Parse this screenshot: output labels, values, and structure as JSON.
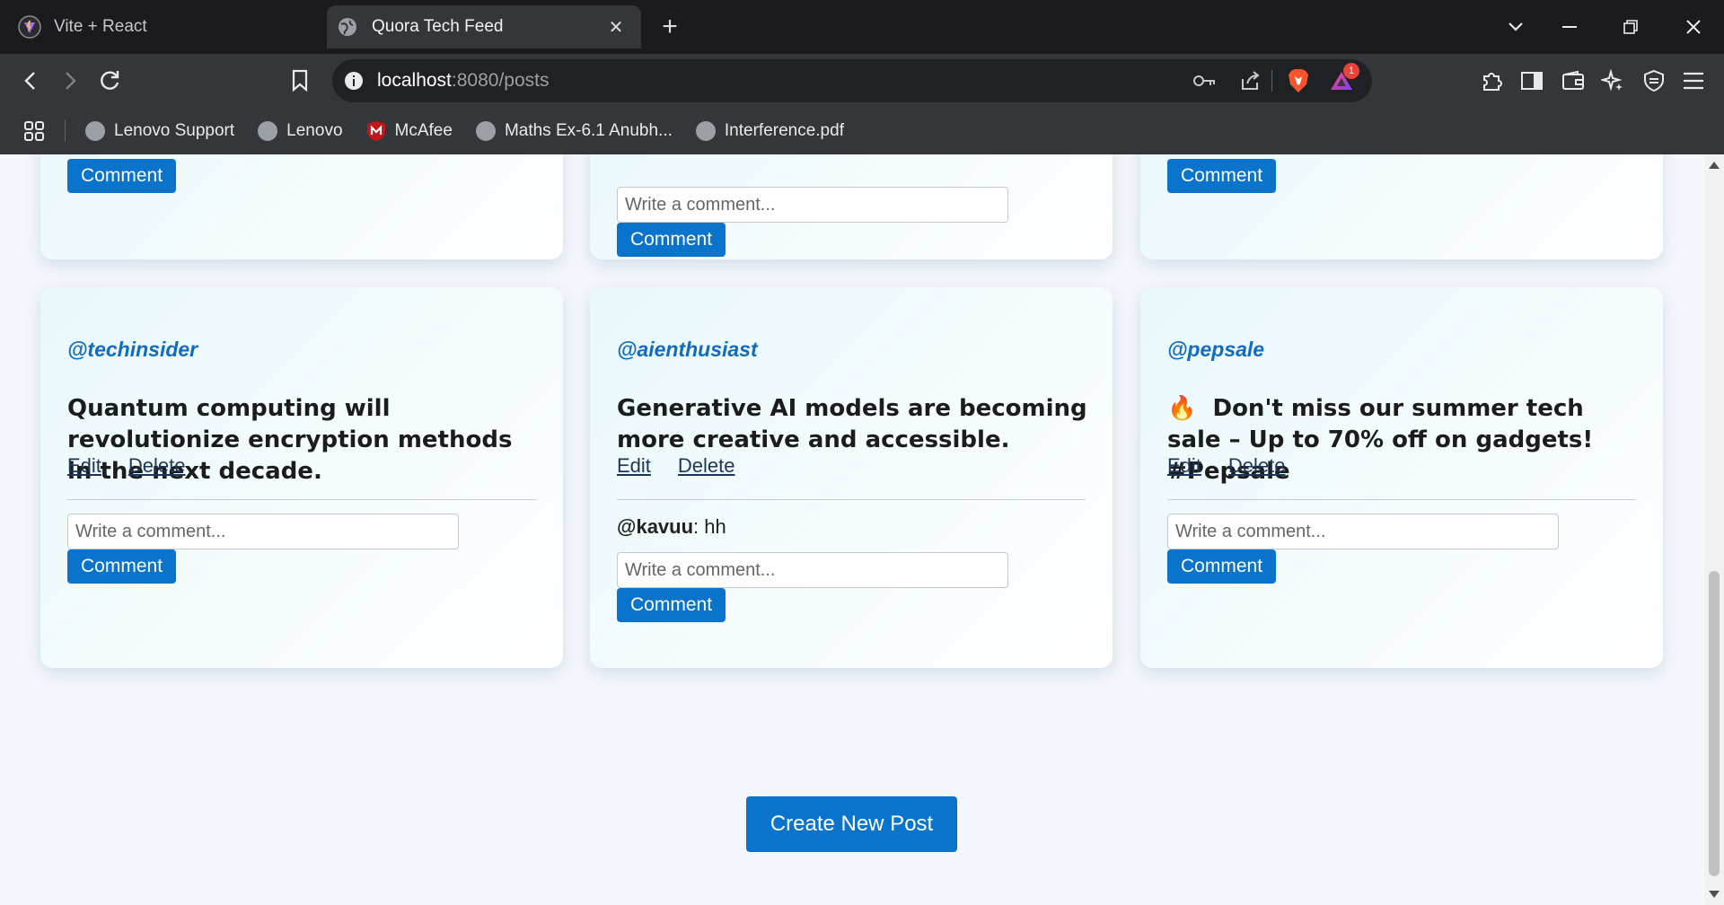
{
  "browser": {
    "tabs": [
      {
        "title": "Vite + React",
        "active": false,
        "icon": "vite-icon"
      },
      {
        "title": "Quora Tech Feed",
        "active": true,
        "icon": "globe-icon"
      }
    ],
    "url_host": "localhost",
    "url_path": ":8080/posts",
    "notification_count": "1",
    "bookmarks": [
      {
        "label": "Lenovo Support",
        "icon": "globe-icon"
      },
      {
        "label": "Lenovo",
        "icon": "globe-icon"
      },
      {
        "label": "McAfee",
        "icon": "mcafee-icon"
      },
      {
        "label": "Maths Ex-6.1 Anubh...",
        "icon": "globe-icon"
      },
      {
        "label": "Interference.pdf",
        "icon": "globe-icon"
      }
    ]
  },
  "feed": {
    "top_row": [
      {
        "button_label": "Comment"
      },
      {
        "comment_placeholder": "Write a comment...",
        "button_label": "Comment"
      },
      {
        "button_label": "Comment"
      }
    ],
    "posts": [
      {
        "handle": "@techinsider",
        "text": "Quantum computing will revolutionize encryption methods in the next decade.",
        "edit_label": "Edit",
        "delete_label": "Delete",
        "comments": [],
        "comment_placeholder": "Write a comment...",
        "comment_button": "Comment"
      },
      {
        "handle": "@aienthusiast",
        "text": "Generative AI models are becoming more creative and accessible.",
        "edit_label": "Edit",
        "delete_label": "Delete",
        "comments": [
          {
            "user": "@kavuu",
            "sep": ":",
            "text": " hh"
          }
        ],
        "comment_placeholder": "Write a comment...",
        "comment_button": "Comment"
      },
      {
        "handle": "@pepsale",
        "emoji": "🔥",
        "text": "Don't miss our summer tech sale – Up to 70% off on gadgets! #Pepsale",
        "edit_label": "Edit",
        "delete_label": "Delete",
        "comments": [],
        "comment_placeholder": "Write a comment...",
        "comment_button": "Comment"
      }
    ],
    "create_button": "Create New Post"
  },
  "colors": {
    "accent": "#0a74cc",
    "handle": "#0f6cc1",
    "link": "#1d3557"
  }
}
